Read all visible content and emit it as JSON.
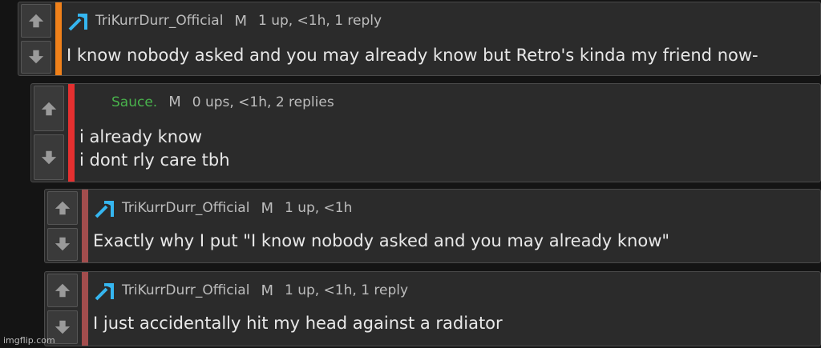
{
  "colors": {
    "accent_orange": "#f0811a",
    "accent_red": "#e53030",
    "accent_muted": "#a34d4d",
    "icon_blue": "#35b6f0",
    "username_green": "#49b34c"
  },
  "comments": [
    {
      "username": "TriKurrDurr_Official",
      "badge": "M",
      "meta": "1 up, <1h, 1 reply",
      "lines": [
        "I know nobody asked and you may already know but Retro's kinda my friend now-"
      ],
      "icon": "pickaxe-icon"
    },
    {
      "username": "Sauce.",
      "badge": "M",
      "meta": "0 ups, <1h, 2 replies",
      "lines": [
        "i already know",
        "i dont rly care tbh"
      ]
    },
    {
      "username": "TriKurrDurr_Official",
      "badge": "M",
      "meta": "1 up, <1h",
      "lines": [
        "Exactly why I put \"I know nobody asked and you may already know\""
      ],
      "icon": "pickaxe-icon"
    },
    {
      "username": "TriKurrDurr_Official",
      "badge": "M",
      "meta": "1 up, <1h, 1 reply",
      "lines": [
        "I just accidentally hit my head against a radiator"
      ],
      "icon": "pickaxe-icon"
    }
  ],
  "watermark": "imgflip.com"
}
